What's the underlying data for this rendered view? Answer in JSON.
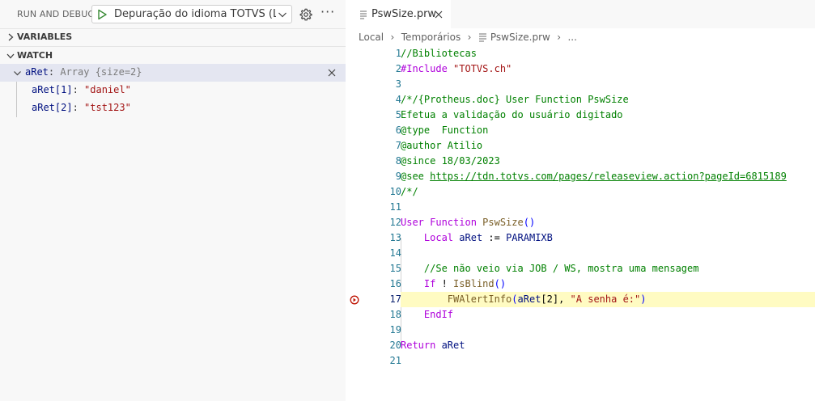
{
  "debug": {
    "title": "RUN AND DEBUG",
    "config_label": "Depuração do idioma TOTVS (Local)",
    "more_label": "···"
  },
  "sections": {
    "variables": "VARIABLES",
    "watch": "WATCH"
  },
  "watch": {
    "expression_name": "aRet",
    "expression_sep": ": ",
    "expression_value": "Array {size=2}",
    "children": [
      {
        "key": "aRet[1]",
        "sep": ": ",
        "value": "\"daniel\""
      },
      {
        "key": "aRet[2]",
        "sep": ": ",
        "value": "\"tst123\""
      }
    ]
  },
  "editor_tab": {
    "label": "PswSize.prw"
  },
  "breadcrumb": [
    "Local",
    "Temporários",
    "PswSize.prw",
    "..."
  ],
  "breadcrumb_separator": "›",
  "code": {
    "line_numbers": [
      "1",
      "2",
      "3",
      "4",
      "5",
      "6",
      "7",
      "8",
      "9",
      "10",
      "11",
      "12",
      "13",
      "14",
      "15",
      "16",
      "17",
      "18",
      "19",
      "20",
      "21"
    ],
    "current_line": "17",
    "lines": [
      [
        {
          "t": "//Bibliotecas",
          "c": "comment"
        }
      ],
      [
        {
          "t": "#Include ",
          "c": "pp"
        },
        {
          "t": "\"TOTVS.ch\"",
          "c": "str"
        }
      ],
      [],
      [
        {
          "t": "/*/{Protheus.doc} User Function PswSize",
          "c": "comment"
        }
      ],
      [
        {
          "t": "Efetua a validação do usuário digitado",
          "c": "comment"
        }
      ],
      [
        {
          "t": "@type  Function",
          "c": "comment"
        }
      ],
      [
        {
          "t": "@author Atilio",
          "c": "comment"
        }
      ],
      [
        {
          "t": "@since 18/03/2023",
          "c": "comment"
        }
      ],
      [
        {
          "t": "@see ",
          "c": "comment"
        },
        {
          "t": "https://tdn.totvs.com/pages/releaseview.action?pageId=6815189",
          "c": "link"
        }
      ],
      [
        {
          "t": "/*/",
          "c": "comment"
        }
      ],
      [],
      [
        {
          "t": "User Function ",
          "c": "kw"
        },
        {
          "t": "PswSize",
          "c": "fn"
        },
        {
          "t": "()",
          "c": "blue"
        }
      ],
      [
        {
          "t": "    "
        },
        {
          "t": "Local ",
          "c": "kw"
        },
        {
          "t": "aRet ",
          "c": "var"
        },
        {
          "t": ":= ",
          "c": "dark"
        },
        {
          "t": "PARAMIXB",
          "c": "var"
        }
      ],
      [],
      [
        {
          "t": "    "
        },
        {
          "t": "//Se não veio via JOB / WS, mostra uma mensagem",
          "c": "comment"
        }
      ],
      [
        {
          "t": "    "
        },
        {
          "t": "If ",
          "c": "kw"
        },
        {
          "t": "! ",
          "c": "dark"
        },
        {
          "t": "IsBlind",
          "c": "fn"
        },
        {
          "t": "()",
          "c": "blue"
        }
      ],
      [
        {
          "t": "        "
        },
        {
          "t": "FWAlertInfo",
          "c": "fn"
        },
        {
          "t": "(",
          "c": "blue"
        },
        {
          "t": "aRet",
          "c": "var"
        },
        {
          "t": "[2], ",
          "c": "dark"
        },
        {
          "t": "\"A senha é:\"",
          "c": "str"
        },
        {
          "t": ")",
          "c": "blue"
        }
      ],
      [
        {
          "t": "    "
        },
        {
          "t": "EndIf",
          "c": "kw"
        }
      ],
      [],
      [
        {
          "t": "Return ",
          "c": "kw"
        },
        {
          "t": "aRet",
          "c": "var"
        }
      ],
      []
    ]
  },
  "colors": {
    "sidebar_bg": "#f8f8f8",
    "watch_selected_bg": "#e4e6f1",
    "current_line_bg": "#fffbc2",
    "line_number": "#237893",
    "comment": "#008000",
    "keyword": "#af00db",
    "string": "#a31515",
    "function": "#795e26",
    "variable": "#001080",
    "debug_arrow": "#be1100",
    "play": "#388a34"
  },
  "icons": {
    "start": "play-icon",
    "dropdown": "chevron-down-icon",
    "settings": "gear-icon",
    "more": "ellipsis-icon",
    "collapse": "chevron-right-icon",
    "expand": "chevron-down-icon",
    "remove": "close-icon",
    "file": "file-lines-icon",
    "current_frame": "debug-stackframe-icon"
  }
}
